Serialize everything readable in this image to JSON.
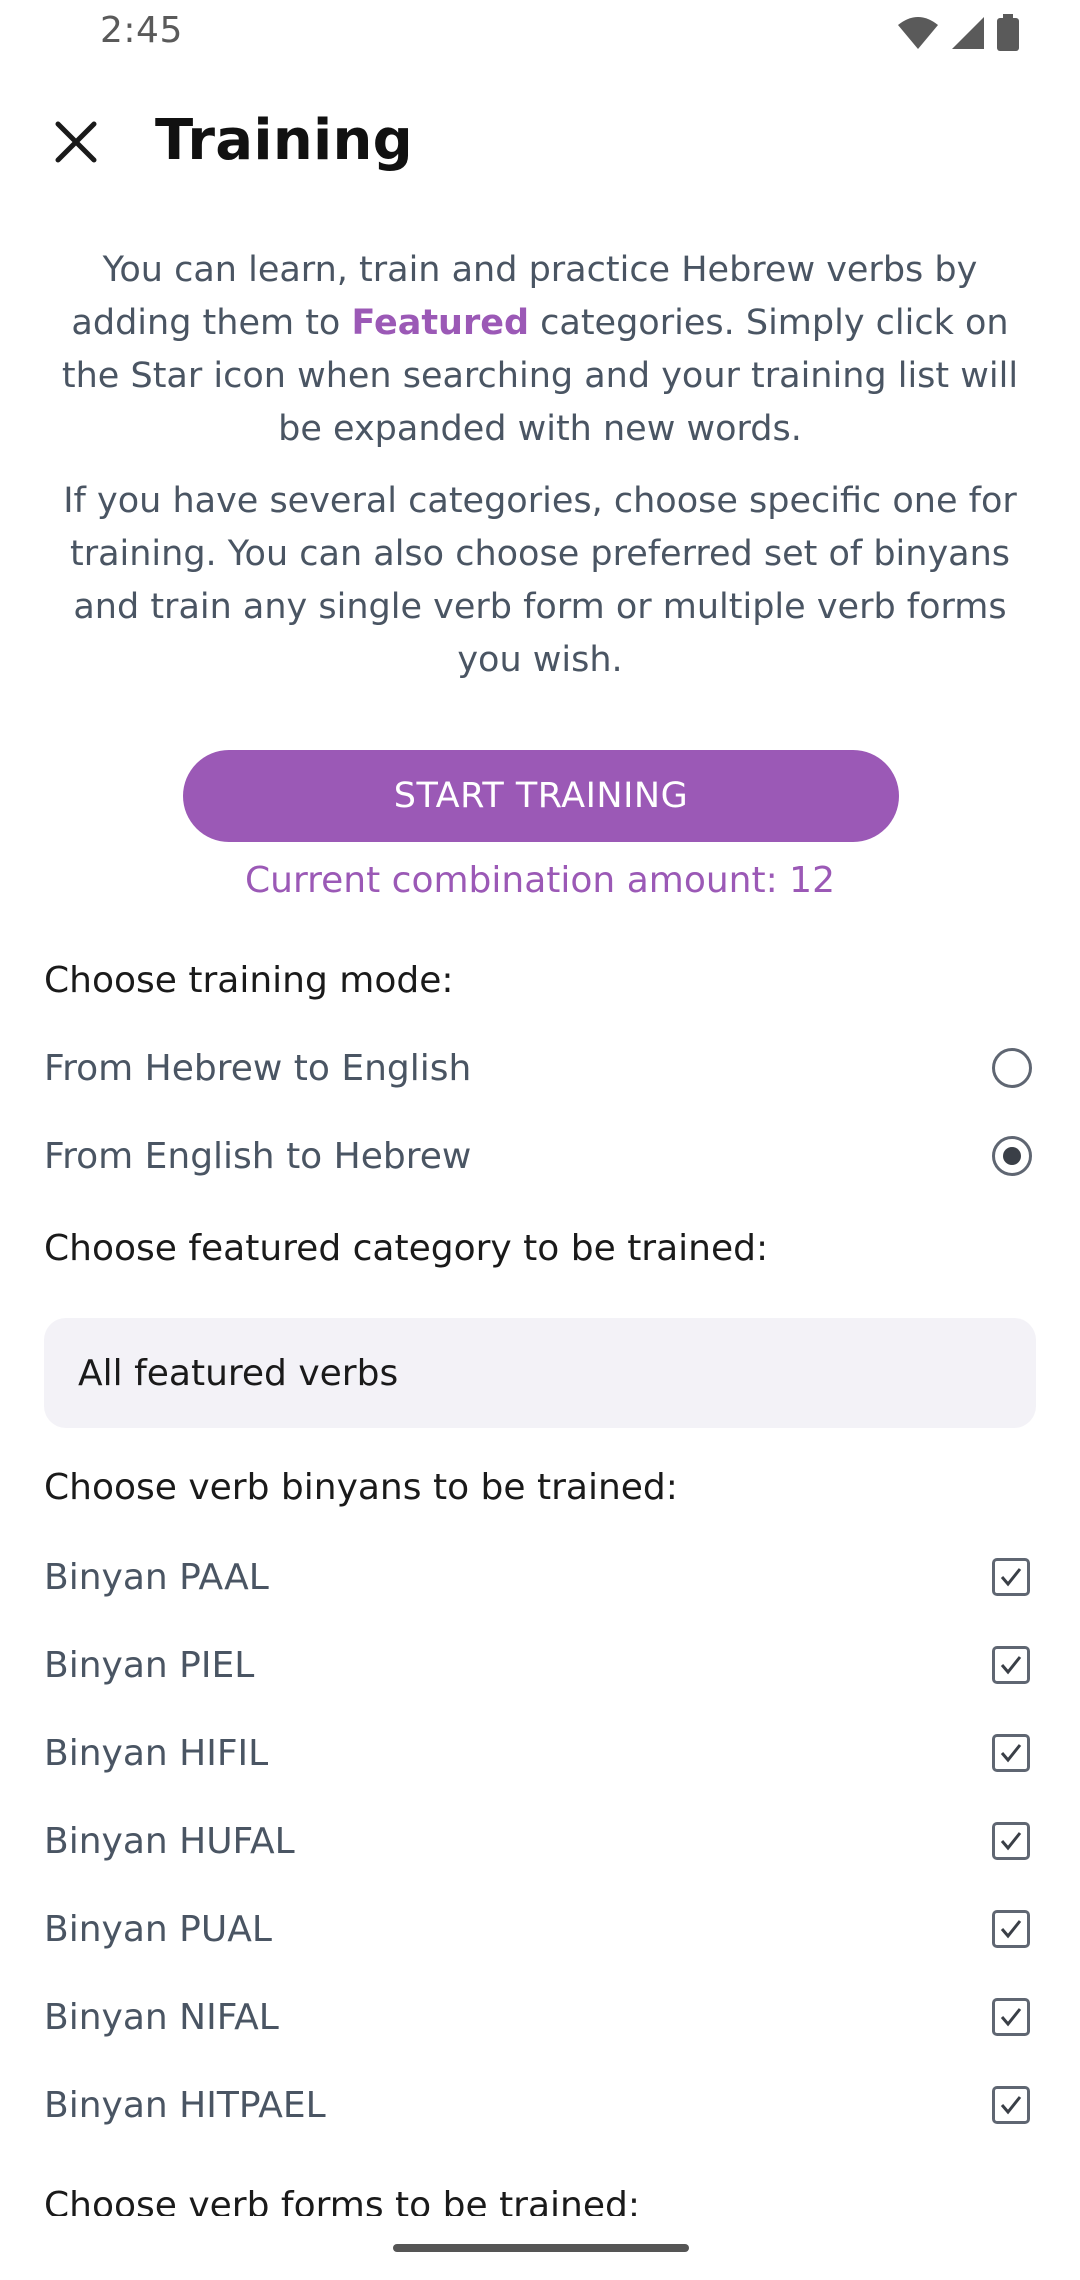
{
  "status_bar": {
    "time": "2:45",
    "icons": [
      "wifi-icon",
      "signal-icon",
      "battery-icon"
    ]
  },
  "app_bar": {
    "title": "Training",
    "close_icon": "close-icon"
  },
  "intro": {
    "p1_before": "You can learn, train and practice Hebrew verbs by adding them to ",
    "p1_highlight": "Featured",
    "p1_after": " categories. Simply click on the Star icon when searching and your training list will be expanded with new words.",
    "p2": "If you have several categories, choose specific one for training. You can also choose preferred set of binyans and train any single verb form or multiple verb forms you wish."
  },
  "start_button": {
    "label": "START TRAINING"
  },
  "combination_text": "Current combination amount: 12",
  "training_mode": {
    "label": "Choose training mode:",
    "options": [
      {
        "label": "From Hebrew to English",
        "selected": false
      },
      {
        "label": "From English to Hebrew",
        "selected": true
      }
    ]
  },
  "category": {
    "label": "Choose featured category to be trained:",
    "selected": "All featured verbs"
  },
  "binyans": {
    "label": "Choose verb binyans  to be trained:",
    "items": [
      {
        "label": "Binyan PAAL",
        "checked": true
      },
      {
        "label": "Binyan PIEL",
        "checked": true
      },
      {
        "label": "Binyan HIFIL",
        "checked": true
      },
      {
        "label": "Binyan HUFAL",
        "checked": true
      },
      {
        "label": "Binyan PUAL",
        "checked": true
      },
      {
        "label": "Binyan NIFAL",
        "checked": true
      },
      {
        "label": "Binyan HITPAEL",
        "checked": true
      }
    ]
  },
  "verb_forms": {
    "label": "Choose verb forms to be trained:"
  },
  "colors": {
    "accent": "#9b59b6",
    "body_text": "#4a5563",
    "dropdown_bg": "#f3f2f7"
  }
}
